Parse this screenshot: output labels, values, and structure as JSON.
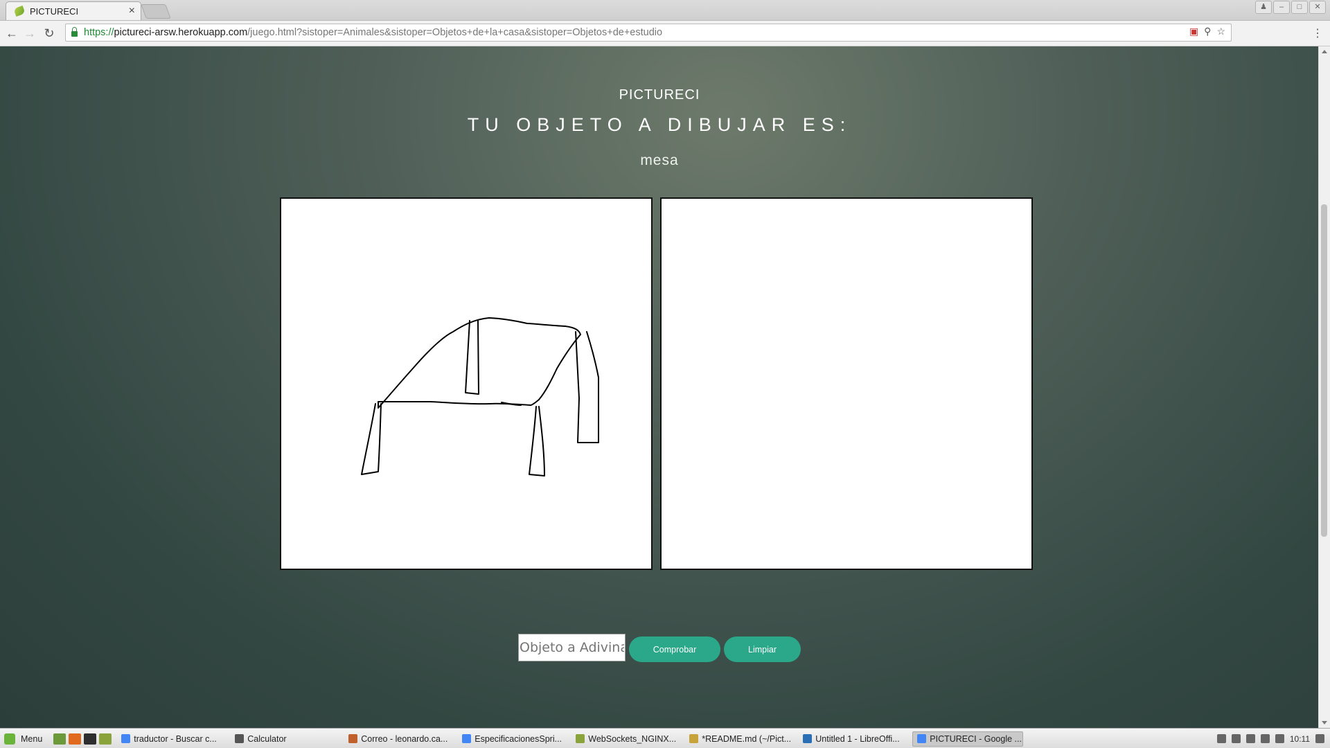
{
  "browser": {
    "tab_title": "PICTURECI",
    "tab_close": "×",
    "url_scheme": "https://",
    "url_host": "pictureci-arsw.herokuapp.com",
    "url_path": "/juego.html?sistoper=Animales&sistoper=Objetos+de+la+casa&sistoper=Objetos+de+estudio"
  },
  "page": {
    "site_name": "PICTURECI",
    "heading": "TU OBJETO A DIBUJAR ES:",
    "word": "mesa",
    "guess_placeholder": "Objeto a Adivinar",
    "check_label": "Comprobar",
    "clear_label": "Limpiar"
  },
  "taskbar": {
    "menu_label": "Menu",
    "tasks": [
      {
        "label": "traductor - Buscar c...",
        "color": "#4285f4"
      },
      {
        "label": "Calculator",
        "color": "#555555"
      },
      {
        "label": "Correo - leonardo.ca...",
        "color": "#c0602b"
      },
      {
        "label": "EspecificacionesSpri...",
        "color": "#4285f4"
      },
      {
        "label": "WebSockets_NGINX...",
        "color": "#8aa33b"
      },
      {
        "label": "*README.md (~/Pict...",
        "color": "#c8a23a"
      },
      {
        "label": "Untitled 1 - LibreOffi...",
        "color": "#2a6fb5"
      },
      {
        "label": "PICTURECI - Google ...",
        "color": "#4285f4"
      }
    ],
    "clock": "10:11"
  }
}
